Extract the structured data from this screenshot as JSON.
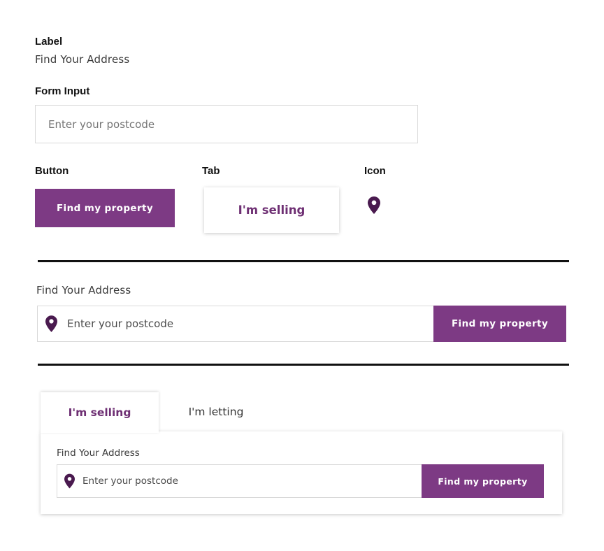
{
  "spec": {
    "label_caption": "Label",
    "label_example": "Find Your Address",
    "form_input_caption": "Form Input",
    "input_placeholder": "Enter your postcode",
    "button_caption": "Button",
    "button_label": "Find my property",
    "tab_caption": "Tab",
    "tab_label": "I'm selling",
    "icon_caption": "Icon",
    "icon_name": "map-pin-icon"
  },
  "search_bar": {
    "label": "Find Your Address",
    "placeholder": "Enter your postcode",
    "button_label": "Find my property",
    "icon_name": "map-pin-icon"
  },
  "tabbed_search": {
    "tabs": [
      {
        "label": "I'm selling",
        "active": true
      },
      {
        "label": "I'm letting",
        "active": false
      }
    ],
    "label": "Find Your Address",
    "placeholder": "Enter your postcode",
    "button_label": "Find my property",
    "icon_name": "map-pin-icon"
  },
  "colors": {
    "brand_purple": "#7d3a84",
    "icon_purple": "#4a1a4f",
    "divider": "#111111"
  }
}
